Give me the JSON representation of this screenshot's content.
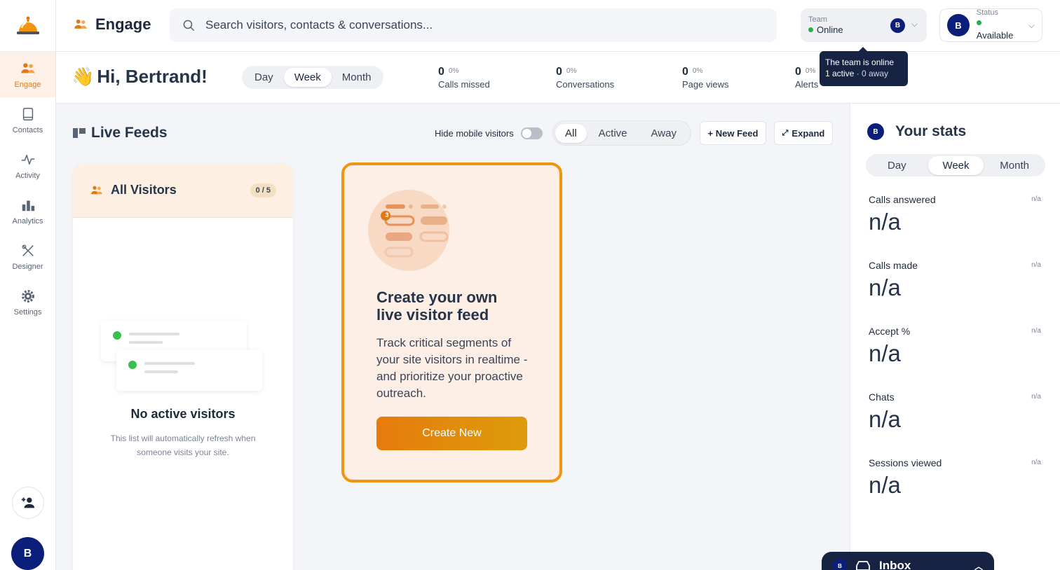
{
  "app": {
    "title": "Engage"
  },
  "sidebar": {
    "items": [
      {
        "label": "Engage",
        "icon": "people-icon",
        "active": true
      },
      {
        "label": "Contacts",
        "icon": "book-icon"
      },
      {
        "label": "Activity",
        "icon": "pulse-icon"
      },
      {
        "label": "Analytics",
        "icon": "bar-chart-icon"
      },
      {
        "label": "Designer",
        "icon": "design-tools-icon"
      },
      {
        "label": "Settings",
        "icon": "gear-icon"
      }
    ],
    "user_initial": "B"
  },
  "search": {
    "placeholder": "Search visitors, contacts & conversations..."
  },
  "team": {
    "label": "Team",
    "value": "Online",
    "avatar": "B"
  },
  "status": {
    "label": "Status",
    "value": "Available",
    "avatar": "B"
  },
  "tooltip": {
    "line1": "The team is online",
    "line2_active": "1 active",
    "line2_away": " · 0 away"
  },
  "greeting": {
    "emoji": "👋",
    "text": "Hi, Bertrand!"
  },
  "period_tabs": [
    "Day",
    "Week",
    "Month"
  ],
  "period_selected": "Week",
  "metrics": [
    {
      "value": "0",
      "pct": "0%",
      "label": "Calls missed"
    },
    {
      "value": "0",
      "pct": "0%",
      "label": "Conversations"
    },
    {
      "value": "0",
      "pct": "0%",
      "label": "Page views"
    },
    {
      "value": "0",
      "pct": "0%",
      "label": "Alerts"
    }
  ],
  "feeds": {
    "title": "Live Feeds",
    "hide_mobile_label": "Hide mobile visitors",
    "filters": [
      "All",
      "Active",
      "Away"
    ],
    "filter_selected": "All",
    "new_feed_label": "+ New Feed",
    "expand_label": "Expand"
  },
  "visitors_card": {
    "title": "All Visitors",
    "count": "0 / 5",
    "empty_title": "No active visitors",
    "empty_sub": "This list will automatically refresh when someone visits your site."
  },
  "create_card": {
    "badge": "3",
    "title_line1": "Create your own",
    "title_line2": "live visitor feed",
    "description": "Track critical segments of your site visitors in realtime - and prioritize your proactive outreach.",
    "button_label": "Create New"
  },
  "stats": {
    "avatar": "B",
    "title": "Your stats",
    "tabs": [
      "Day",
      "Week",
      "Month"
    ],
    "tab_selected": "Week",
    "rows": [
      {
        "name": "Calls answered",
        "small": "n/a",
        "value": "n/a"
      },
      {
        "name": "Calls made",
        "small": "n/a",
        "value": "n/a"
      },
      {
        "name": "Accept %",
        "small": "n/a",
        "value": "n/a"
      },
      {
        "name": "Chats",
        "small": "n/a",
        "value": "n/a"
      },
      {
        "name": "Sessions viewed",
        "small": "n/a",
        "value": "n/a"
      }
    ]
  },
  "inbox": {
    "label": "Inbox",
    "avatar": "B"
  },
  "colors": {
    "accent": "#e07a12",
    "navy": "#0b1f7a",
    "online": "#1fb24a",
    "tooltip_bg": "#172343"
  }
}
